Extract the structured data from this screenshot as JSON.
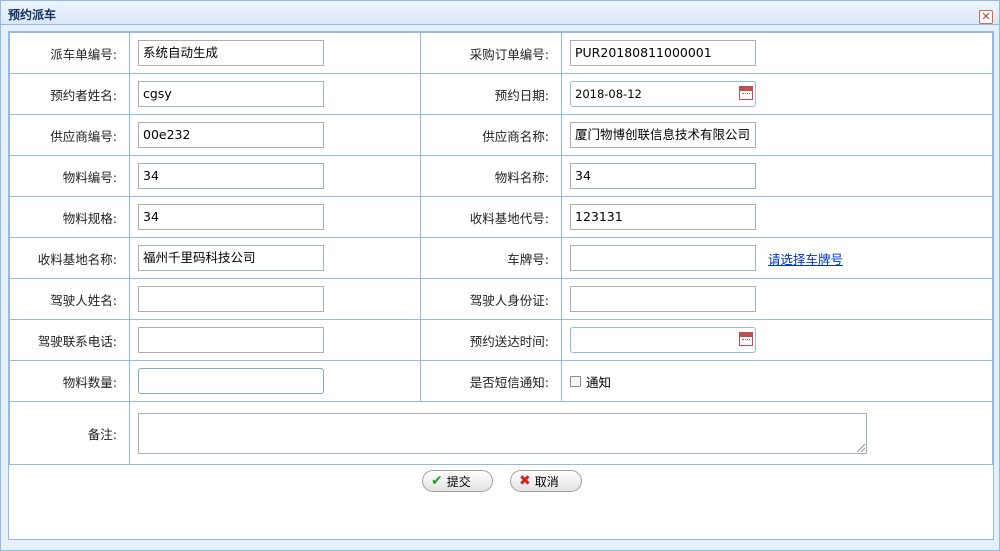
{
  "dialog": {
    "title": "预约派车",
    "close_symbol": "✕"
  },
  "form": {
    "rows": [
      {
        "l1": "派车单编号:",
        "v1": "系统自动生成",
        "l2": "采购订单编号:",
        "v2": "PUR20180811000001"
      },
      {
        "l1": "预约者姓名:",
        "v1": "cgsy",
        "l2": "预约日期:",
        "v2": "2018-08-12"
      },
      {
        "l1": "供应商编号:",
        "v1": "00e232",
        "l2": "供应商名称:",
        "v2": "厦门物博创联信息技术有限公司"
      },
      {
        "l1": "物料编号:",
        "v1": "34",
        "l2": "物料名称:",
        "v2": "34"
      },
      {
        "l1": "物料规格:",
        "v1": "34",
        "l2": "收料基地代号:",
        "v2": "123131"
      },
      {
        "l1": "收料基地名称:",
        "v1": "福州千里码科技公司",
        "l2": "车牌号:",
        "v2": "",
        "link": "请选择车牌号"
      },
      {
        "l1": "驾驶人姓名:",
        "v1": "",
        "l2": "驾驶人身份证:",
        "v2": ""
      },
      {
        "l1": "驾驶联系电话:",
        "v1": "",
        "l2": "预约送达时间:",
        "v2": ""
      },
      {
        "l1": "物料数量:",
        "v1": "",
        "l2": "是否短信通知:",
        "checkbox_label": "通知"
      }
    ],
    "remark_label": "备注:",
    "remark_value": ""
  },
  "buttons": {
    "submit": "提交",
    "cancel": "取消"
  },
  "icons": {
    "submit": "check-icon",
    "cancel": "cross-icon",
    "date": "calendar-icon"
  }
}
